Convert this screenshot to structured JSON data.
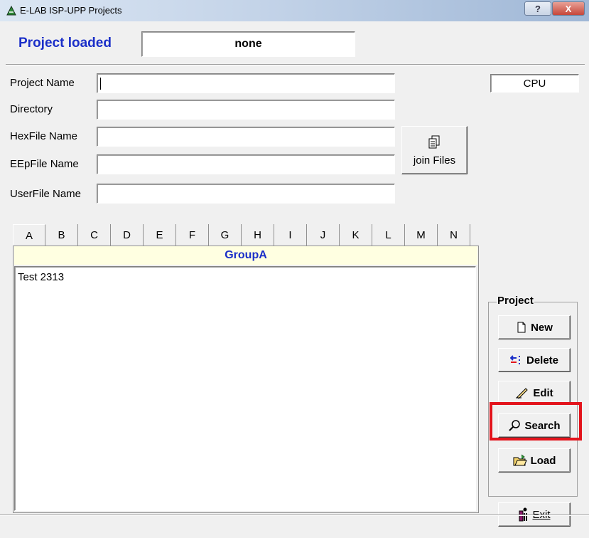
{
  "window": {
    "title": "E-LAB ISP-UPP Projects",
    "help_label": "?",
    "close_label": "X"
  },
  "project_loaded": {
    "label": "Project loaded",
    "value": "none"
  },
  "fields": [
    {
      "label": "Project Name",
      "value": ""
    },
    {
      "label": "Directory",
      "value": ""
    },
    {
      "label": "HexFile Name",
      "value": ""
    },
    {
      "label": "EEpFile Name",
      "value": ""
    },
    {
      "label": "UserFile Name",
      "value": ""
    }
  ],
  "cpu": {
    "value": "CPU"
  },
  "join_button": {
    "label": "join Files",
    "icon": "copy-files-icon"
  },
  "tabs": [
    "A",
    "B",
    "C",
    "D",
    "E",
    "F",
    "G",
    "H",
    "I",
    "J",
    "K",
    "L",
    "M",
    "N"
  ],
  "active_tab": "A",
  "group": {
    "header": "GroupA",
    "items": [
      "Test 2313"
    ]
  },
  "project_frame": {
    "label": "Project",
    "buttons": [
      {
        "label": "New",
        "icon": "new-document-icon"
      },
      {
        "label": "Delete",
        "icon": "delete-icon"
      },
      {
        "label": "Edit",
        "icon": "pencil-icon"
      },
      {
        "label": "Search",
        "icon": "magnifier-icon"
      },
      {
        "label": "Load",
        "icon": "open-folder-icon"
      }
    ]
  },
  "exit_button": {
    "label": "Exit",
    "icon": "exit-door-icon"
  },
  "colors": {
    "accent_blue": "#1a2ec8",
    "highlight_red": "#e3141c",
    "group_header_bg": "#ffffe1"
  }
}
